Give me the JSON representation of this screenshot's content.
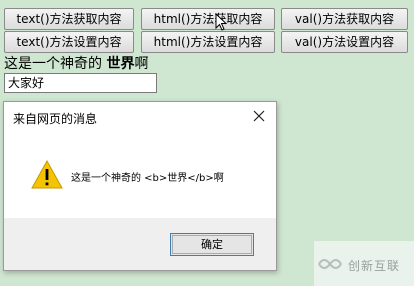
{
  "buttons": {
    "text_get": "text()方法获取内容",
    "html_get": "html()方法获取内容",
    "val_get": "val()方法获取内容",
    "text_set": "text()方法设置内容",
    "html_set": "html()方法设置内容",
    "val_set": "val()方法设置内容"
  },
  "paragraph": {
    "prefix": "这是一个神奇的 ",
    "bold": "世界",
    "suffix": "啊"
  },
  "input": {
    "value": "大家好"
  },
  "dialog": {
    "title": "来自网页的消息",
    "message": "这是一个神奇的 <b>世界</b>啊",
    "ok_label": "确定",
    "icon": "warning-icon"
  },
  "watermark": {
    "text": "创新互联"
  },
  "colors": {
    "page_background": "#cfe6d1",
    "warning": "#f5c400"
  }
}
